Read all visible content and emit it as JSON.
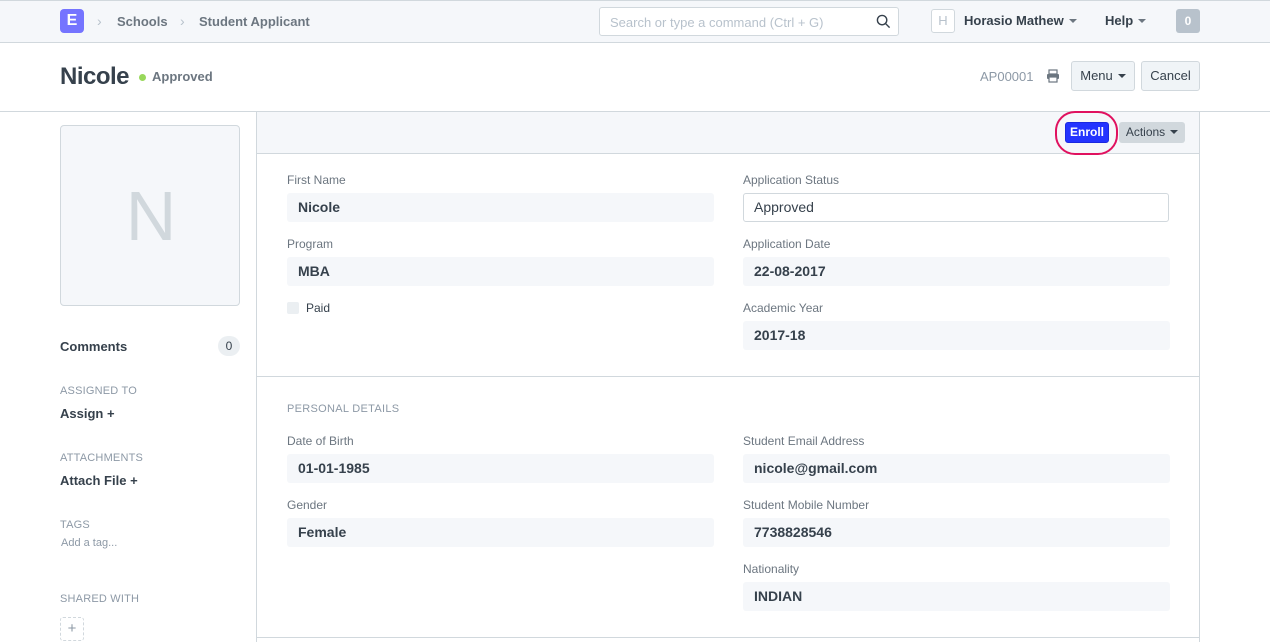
{
  "navbar": {
    "logo_letter": "E",
    "breadcrumbs": [
      "Schools",
      "Student Applicant"
    ],
    "search_placeholder": "Search or type a command (Ctrl + G)",
    "user_initial": "H",
    "user_name": "Horasio Mathew",
    "help_label": "Help",
    "notification_count": "0"
  },
  "page_head": {
    "title": "Nicole",
    "status": "Approved",
    "status_color": "#98d85b",
    "doc_id": "AP00001",
    "menu_label": "Menu",
    "cancel_label": "Cancel"
  },
  "sidebar": {
    "image_initial": "N",
    "comments_label": "Comments",
    "comments_count": "0",
    "assigned_to_label": "ASSIGNED TO",
    "assign_label": "Assign +",
    "attachments_label": "ATTACHMENTS",
    "attach_label": "Attach File +",
    "tags_label": "TAGS",
    "add_tag_label": "Add a tag...",
    "shared_with_label": "SHARED WITH",
    "share_plus": "+"
  },
  "toolbar": {
    "enroll_label": "Enroll",
    "actions_label": "Actions",
    "enroll_color": "#2434ff",
    "highlight_color": "#e0115f"
  },
  "form": {
    "first_name_label": "First Name",
    "first_name": "Nicole",
    "program_label": "Program",
    "program": "MBA",
    "paid_label": "Paid",
    "application_status_label": "Application Status",
    "application_status": "Approved",
    "application_date_label": "Application Date",
    "application_date": "22-08-2017",
    "academic_year_label": "Academic Year",
    "academic_year": "2017-18",
    "personal_section": "PERSONAL DETAILS",
    "dob_label": "Date of Birth",
    "dob": "01-01-1985",
    "gender_label": "Gender",
    "gender": "Female",
    "email_label": "Student Email Address",
    "email": "nicole@gmail.com",
    "mobile_label": "Student Mobile Number",
    "mobile": "7738828546",
    "nationality_label": "Nationality",
    "nationality": "INDIAN"
  }
}
